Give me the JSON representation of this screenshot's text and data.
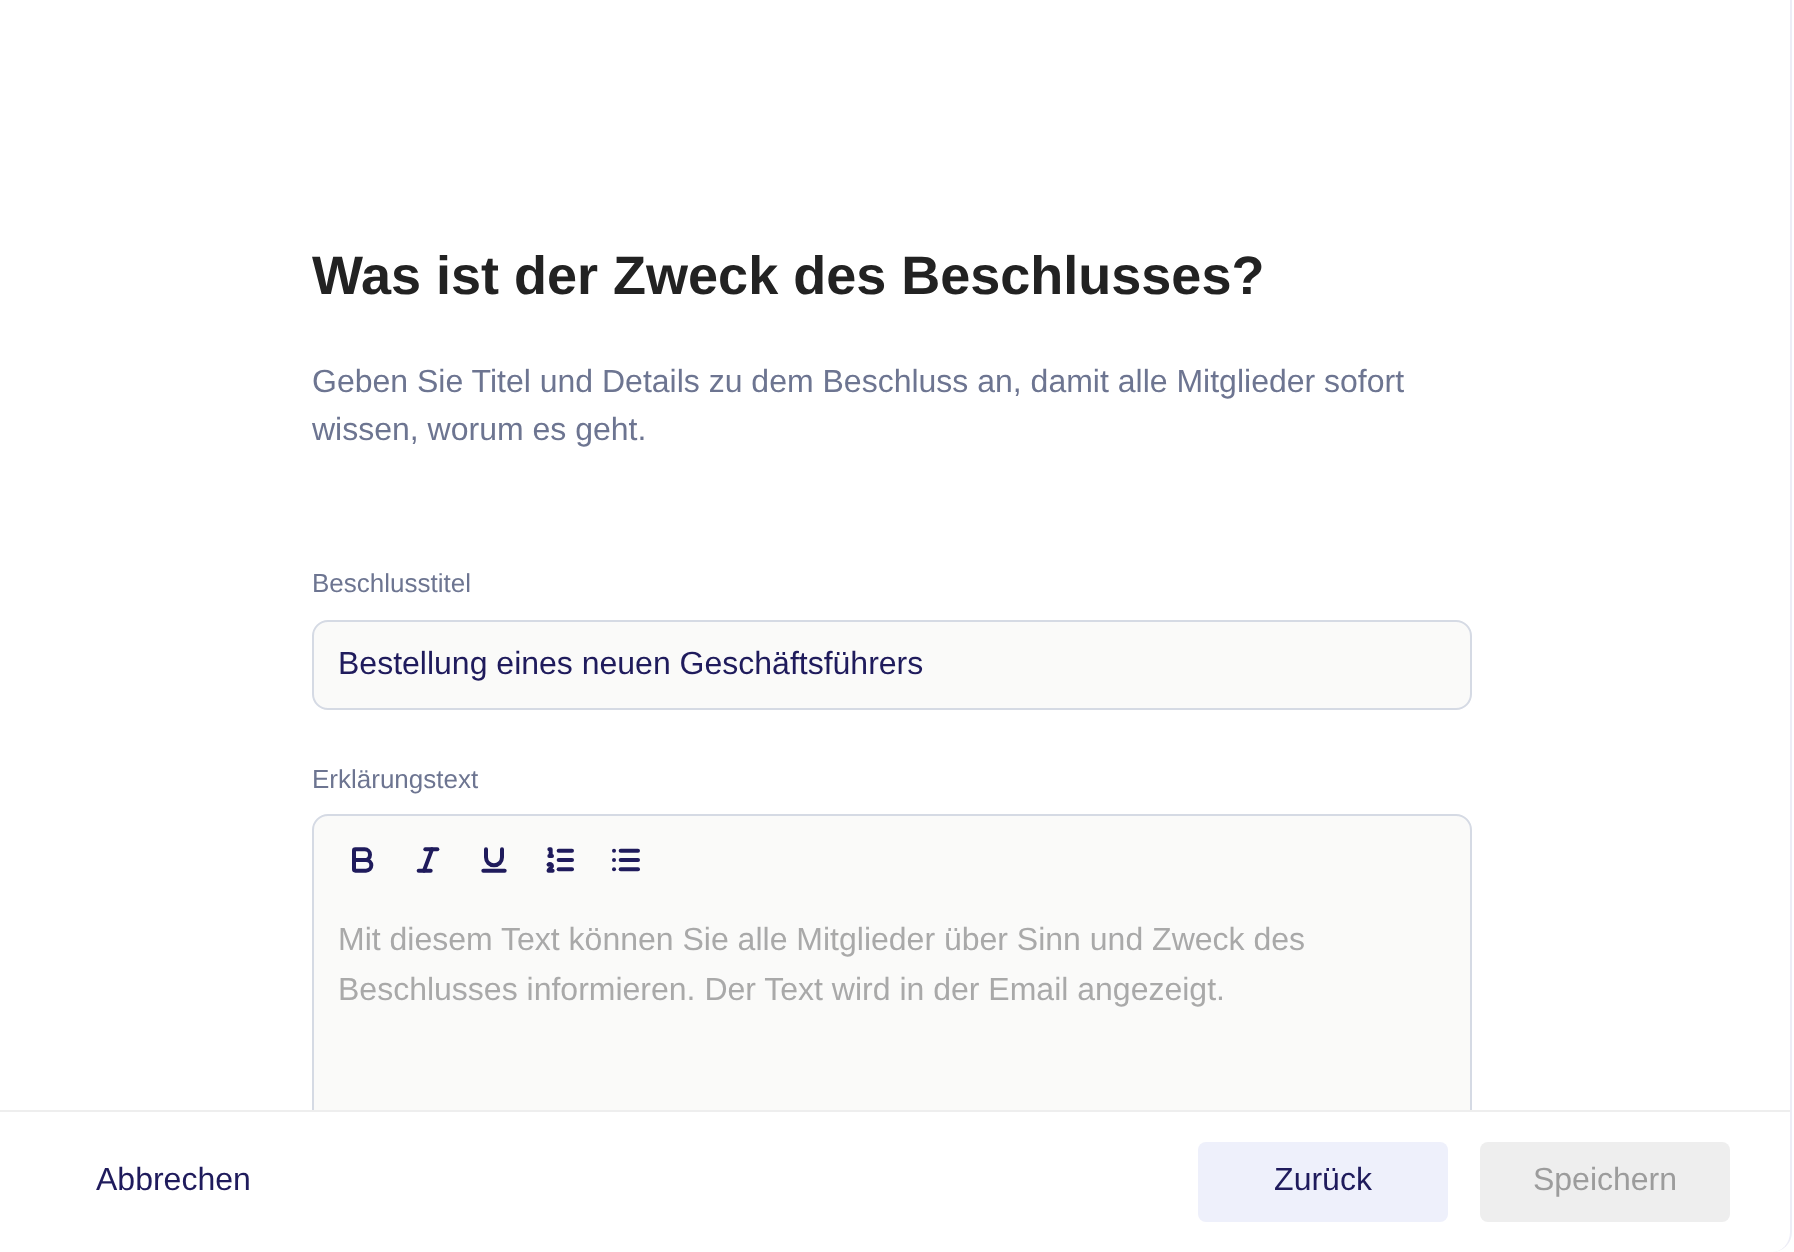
{
  "heading": "Was ist der Zweck des Beschlusses?",
  "description": "Geben Sie Titel und Details zu dem Beschluss an, damit alle Mitglieder sofort wissen, worum es geht.",
  "title_field": {
    "label": "Beschlusstitel",
    "value": "Bestellung eines neuen Geschäftsführers"
  },
  "editor": {
    "label": "Erklärungstext",
    "toolbar": [
      {
        "kind": "bold"
      },
      {
        "kind": "italic"
      },
      {
        "kind": "underline"
      },
      {
        "kind": "ordered-list"
      },
      {
        "kind": "bullet-list"
      }
    ],
    "placeholder": "Mit diesem Text können Sie alle Mitglieder über Sinn und Zweck des Beschlusses informieren. Der Text wird in der Email angezeigt."
  },
  "footer": {
    "cancel": "Abbrechen",
    "buttons": [
      {
        "label": "Zurück",
        "kind": "secondary",
        "disabled": false
      },
      {
        "label": "Speichern",
        "kind": "primary",
        "disabled": true
      }
    ]
  }
}
